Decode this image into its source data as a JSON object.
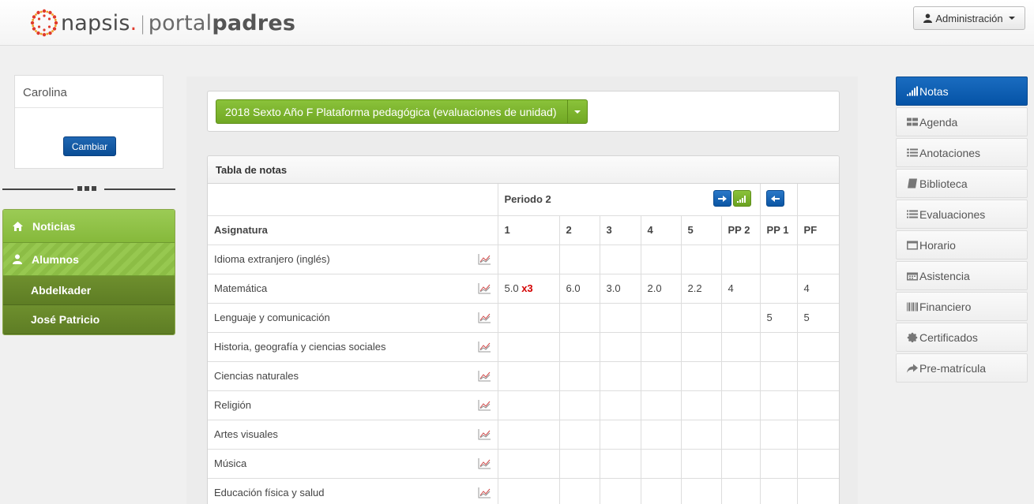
{
  "header": {
    "logo": {
      "brand": "napsis",
      "dot": ".",
      "separator": "|",
      "portal": "portal",
      "padres": "padres"
    },
    "admin_label": "Administración"
  },
  "user": {
    "name": "Carolina",
    "change_label": "Cambiar"
  },
  "left_nav": {
    "noticias": "Noticias",
    "alumnos": "Alumnos",
    "students": [
      "Abdelkader",
      "José Patricio"
    ]
  },
  "year_selector": {
    "label": "2018 Sexto Año F Plataforma pedagógica (evaluaciones de unidad)"
  },
  "grades": {
    "title": "Tabla de notas",
    "period_label": "Periodo 2",
    "subject_header": "Asignatura",
    "columns": [
      "1",
      "2",
      "3",
      "4",
      "5",
      "PP 2",
      "PP 1",
      "PF"
    ],
    "rows": [
      {
        "subject": "Idioma extranjero (inglés)",
        "c1": "",
        "c1_mult": "",
        "c2": "",
        "c3": "",
        "c4": "",
        "c5": "",
        "pp2": "",
        "pp1": "",
        "pf": ""
      },
      {
        "subject": "Matemática",
        "c1": "5.0",
        "c1_mult": "x3",
        "c2": "6.0",
        "c3": "3.0",
        "c4": "2.0",
        "c5": "2.2",
        "pp2": "4",
        "pp1": "",
        "pf": "4"
      },
      {
        "subject": "Lenguaje y comunicación",
        "c1": "",
        "c1_mult": "",
        "c2": "",
        "c3": "",
        "c4": "",
        "c5": "",
        "pp2": "",
        "pp1": "5",
        "pf": "5"
      },
      {
        "subject": "Historia, geografía y ciencias sociales",
        "c1": "",
        "c1_mult": "",
        "c2": "",
        "c3": "",
        "c4": "",
        "c5": "",
        "pp2": "",
        "pp1": "",
        "pf": ""
      },
      {
        "subject": "Ciencias naturales",
        "c1": "",
        "c1_mult": "",
        "c2": "",
        "c3": "",
        "c4": "",
        "c5": "",
        "pp2": "",
        "pp1": "",
        "pf": ""
      },
      {
        "subject": "Religión",
        "c1": "",
        "c1_mult": "",
        "c2": "",
        "c3": "",
        "c4": "",
        "c5": "",
        "pp2": "",
        "pp1": "",
        "pf": ""
      },
      {
        "subject": "Artes visuales",
        "c1": "",
        "c1_mult": "",
        "c2": "",
        "c3": "",
        "c4": "",
        "c5": "",
        "pp2": "",
        "pp1": "",
        "pf": ""
      },
      {
        "subject": "Música",
        "c1": "",
        "c1_mult": "",
        "c2": "",
        "c3": "",
        "c4": "",
        "c5": "",
        "pp2": "",
        "pp1": "",
        "pf": ""
      },
      {
        "subject": "Educación física y salud",
        "c1": "",
        "c1_mult": "",
        "c2": "",
        "c3": "",
        "c4": "",
        "c5": "",
        "pp2": "",
        "pp1": "",
        "pf": ""
      }
    ]
  },
  "right_nav": [
    {
      "label": "Notas",
      "icon": "signal-bars-icon",
      "active": true
    },
    {
      "label": "Agenda",
      "icon": "grid-icon",
      "active": false
    },
    {
      "label": "Anotaciones",
      "icon": "grid-list-icon",
      "active": false
    },
    {
      "label": "Biblioteca",
      "icon": "book-icon",
      "active": false
    },
    {
      "label": "Evaluaciones",
      "icon": "list-icon",
      "active": false
    },
    {
      "label": "Horario",
      "icon": "window-icon",
      "active": false
    },
    {
      "label": "Asistencia",
      "icon": "calendar-icon",
      "active": false
    },
    {
      "label": "Financiero",
      "icon": "barcode-icon",
      "active": false
    },
    {
      "label": "Certificados",
      "icon": "certificate-icon",
      "active": false
    },
    {
      "label": "Pre-matrícula",
      "icon": "share-arrow-icon",
      "active": false
    }
  ],
  "colors": {
    "accent_blue": "#0b55a3",
    "accent_green": "#8ac23a",
    "dark_green": "#5e7d24",
    "logo_red": "#e03a2c"
  }
}
